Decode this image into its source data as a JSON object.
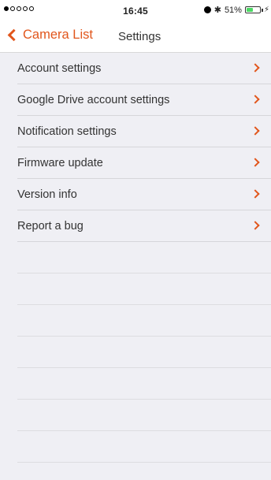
{
  "status_bar": {
    "time": "16:45",
    "battery_percent_label": "51%",
    "battery_level": 0.51,
    "signal_bars_filled": 1,
    "signal_bars_total": 5
  },
  "nav": {
    "back_label": "Camera List",
    "title": "Settings"
  },
  "settings_items": [
    {
      "label": "Account settings"
    },
    {
      "label": "Google Drive account settings"
    },
    {
      "label": "Notification settings"
    },
    {
      "label": "Firmware update"
    },
    {
      "label": "Version info"
    },
    {
      "label": "Report a bug"
    }
  ],
  "colors": {
    "accent": "#e1561c",
    "background": "#efeff4",
    "battery": "#4cd964"
  }
}
